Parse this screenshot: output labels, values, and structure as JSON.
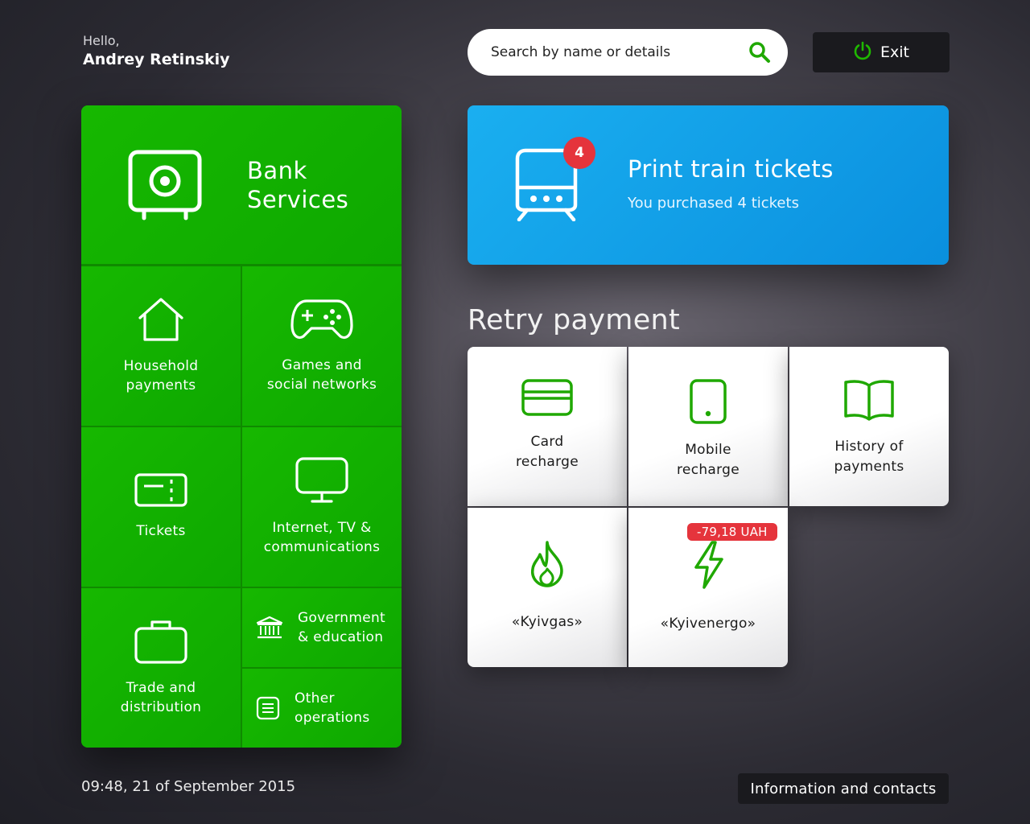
{
  "header": {
    "hello": "Hello,",
    "user_name": "Andrey Retinskiy",
    "search_placeholder": "Search by name or details",
    "exit_label": "Exit"
  },
  "categories": {
    "bank": "Bank\nServices",
    "household": "Household\npayments",
    "games": "Games and\nsocial networks",
    "tickets": "Tickets",
    "internet": "Internet, TV &\ncommunications",
    "trade": "Trade and\ndistribution",
    "government": "Government\n& education",
    "other": "Other\noperations"
  },
  "train_card": {
    "title": "Print train tickets",
    "subtitle": "You purchased 4 tickets",
    "badge_count": "4"
  },
  "retry": {
    "title": "Retry payment",
    "items": [
      {
        "label": "Card\nrecharge",
        "icon": "credit-card-icon"
      },
      {
        "label": "Mobile\nrecharge",
        "icon": "phone-icon"
      },
      {
        "label": "History of\npayments",
        "icon": "book-icon"
      },
      {
        "label": "«Kyivgas»",
        "icon": "flame-icon"
      },
      {
        "label": "«Kyivenergo»",
        "icon": "lightning-icon",
        "debt": "-79,18 UAH"
      }
    ]
  },
  "footer": {
    "datetime": "09:48, 21 of September 2015",
    "info_label": "Information and contacts"
  },
  "colors": {
    "green": "#12b000",
    "blue": "#14a8ee",
    "red_badge": "#e5343c",
    "icon_green": "#1fa800"
  }
}
